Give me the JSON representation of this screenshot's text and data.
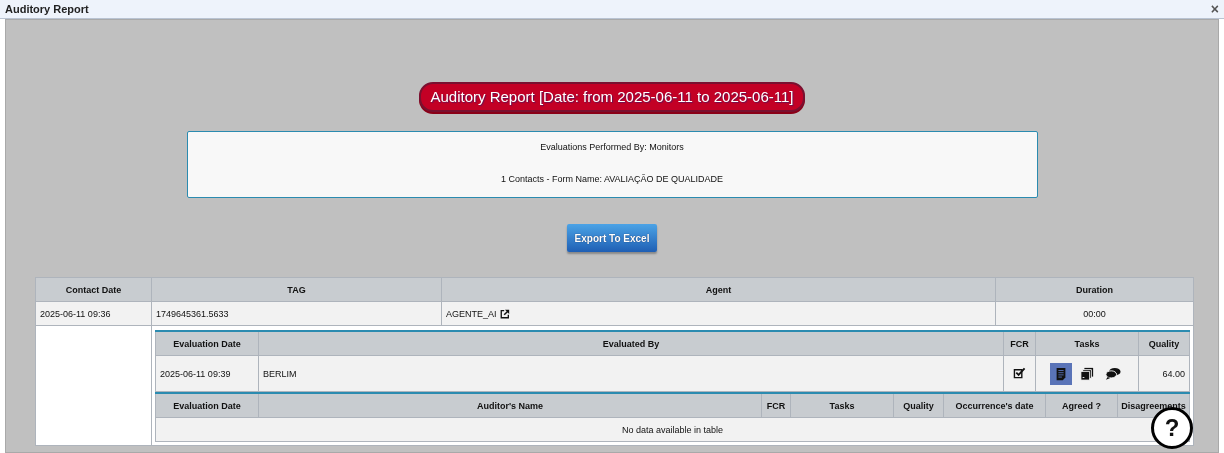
{
  "window": {
    "title": "Auditory Report",
    "close": "×"
  },
  "banner": "Auditory Report [Date: from 2025-06-11 to 2025-06-11]",
  "info": [
    "Evaluations Performed By: Monitors",
    "1 Contacts - Form Name: AVALIAÇÃO DE QUALIDADE"
  ],
  "export_button": "Export To Excel",
  "contacts": {
    "columns": [
      "Contact Date",
      "TAG",
      "Agent",
      "Duration"
    ],
    "rows": [
      {
        "contact_date": "2025-06-11 09:36",
        "tag": "1749645361.5633",
        "agent": "AGENTE_AI",
        "duration": "00:00",
        "evaluations": {
          "columns": [
            "Evaluation Date",
            "Evaluated By",
            "FCR",
            "Tasks",
            "Quality"
          ],
          "rows": [
            {
              "evaluation_date": "2025-06-11 09:39",
              "evaluated_by": "BERLIM",
              "fcr_checked": true,
              "tasks": [
                {
                  "kind": "document",
                  "selected": true
                },
                {
                  "kind": "copies",
                  "selected": false
                },
                {
                  "kind": "chat",
                  "selected": false
                }
              ],
              "quality": "64.00"
            }
          ]
        },
        "audits": {
          "columns": [
            "Evaluation Date",
            "Auditor's Name",
            "FCR",
            "Tasks",
            "Quality",
            "Occurrence's date",
            "Agreed ?",
            "Disagreements"
          ],
          "empty": "No data available in table"
        }
      }
    ]
  },
  "help_button": "?"
}
